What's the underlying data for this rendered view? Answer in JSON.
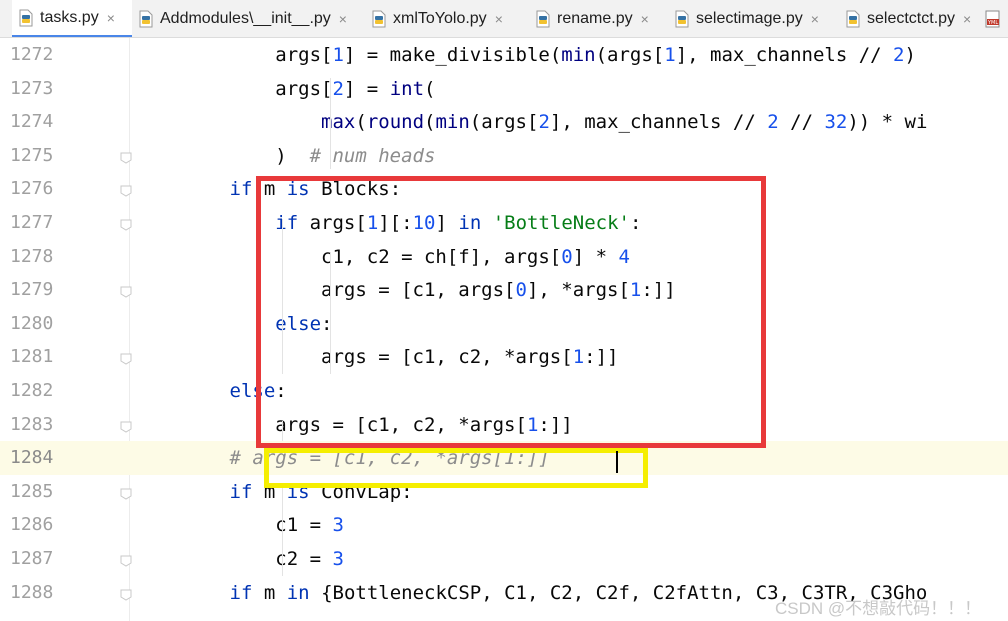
{
  "tabs": [
    {
      "label": "tasks.py",
      "active": true,
      "icon": "python-file-icon"
    },
    {
      "label": "Addmodules\\__init__.py",
      "active": false,
      "icon": "python-file-icon"
    },
    {
      "label": "xmlToYolo.py",
      "active": false,
      "icon": "python-file-icon"
    },
    {
      "label": "rename.py",
      "active": false,
      "icon": "python-file-icon"
    },
    {
      "label": "selectimage.py",
      "active": false,
      "icon": "python-file-icon"
    },
    {
      "label": "selectctct.py",
      "active": false,
      "icon": "python-file-icon"
    },
    {
      "label": "",
      "active": false,
      "icon": "yaml-file-icon"
    }
  ],
  "close_glyph": "×",
  "lines": [
    {
      "num": "1272",
      "segments": [
        {
          "t": "            args[",
          "c": ""
        },
        {
          "t": "1",
          "c": "num"
        },
        {
          "t": "] = make_divisible(",
          "c": ""
        },
        {
          "t": "min",
          "c": "bi"
        },
        {
          "t": "(args[",
          "c": ""
        },
        {
          "t": "1",
          "c": "num"
        },
        {
          "t": "], max_channels // ",
          "c": ""
        },
        {
          "t": "2",
          "c": "num"
        },
        {
          "t": ")",
          "c": ""
        }
      ]
    },
    {
      "num": "1273",
      "segments": [
        {
          "t": "            args[",
          "c": ""
        },
        {
          "t": "2",
          "c": "num"
        },
        {
          "t": "] = ",
          "c": ""
        },
        {
          "t": "int",
          "c": "bi"
        },
        {
          "t": "(",
          "c": ""
        }
      ]
    },
    {
      "num": "1274",
      "segments": [
        {
          "t": "                ",
          "c": ""
        },
        {
          "t": "max",
          "c": "bi"
        },
        {
          "t": "(",
          "c": ""
        },
        {
          "t": "round",
          "c": "bi"
        },
        {
          "t": "(",
          "c": ""
        },
        {
          "t": "min",
          "c": "bi"
        },
        {
          "t": "(args[",
          "c": ""
        },
        {
          "t": "2",
          "c": "num"
        },
        {
          "t": "], max_channels // ",
          "c": ""
        },
        {
          "t": "2",
          "c": "num"
        },
        {
          "t": " // ",
          "c": ""
        },
        {
          "t": "32",
          "c": "num"
        },
        {
          "t": ")) * wi",
          "c": ""
        }
      ]
    },
    {
      "num": "1275",
      "segments": [
        {
          "t": "            )  ",
          "c": ""
        },
        {
          "t": "# num heads",
          "c": "cmt"
        }
      ]
    },
    {
      "num": "1276",
      "segments": [
        {
          "t": "        ",
          "c": ""
        },
        {
          "t": "if",
          "c": "kw"
        },
        {
          "t": " m ",
          "c": ""
        },
        {
          "t": "is",
          "c": "kw"
        },
        {
          "t": " Blocks:",
          "c": ""
        }
      ]
    },
    {
      "num": "1277",
      "segments": [
        {
          "t": "            ",
          "c": ""
        },
        {
          "t": "if",
          "c": "kw"
        },
        {
          "t": " args[",
          "c": ""
        },
        {
          "t": "1",
          "c": "num"
        },
        {
          "t": "][:",
          "c": ""
        },
        {
          "t": "10",
          "c": "num"
        },
        {
          "t": "] ",
          "c": ""
        },
        {
          "t": "in",
          "c": "kw"
        },
        {
          "t": " ",
          "c": ""
        },
        {
          "t": "'BottleNeck'",
          "c": "str"
        },
        {
          "t": ":",
          "c": ""
        }
      ]
    },
    {
      "num": "1278",
      "segments": [
        {
          "t": "                c1, c2 = ch[f], args[",
          "c": ""
        },
        {
          "t": "0",
          "c": "num"
        },
        {
          "t": "] * ",
          "c": ""
        },
        {
          "t": "4",
          "c": "num"
        }
      ]
    },
    {
      "num": "1279",
      "segments": [
        {
          "t": "                args = [c1, args[",
          "c": ""
        },
        {
          "t": "0",
          "c": "num"
        },
        {
          "t": "], *args[",
          "c": ""
        },
        {
          "t": "1",
          "c": "num"
        },
        {
          "t": ":]]",
          "c": ""
        }
      ]
    },
    {
      "num": "1280",
      "segments": [
        {
          "t": "            ",
          "c": ""
        },
        {
          "t": "else",
          "c": "kw"
        },
        {
          "t": ":",
          "c": ""
        }
      ]
    },
    {
      "num": "1281",
      "segments": [
        {
          "t": "                args = [c1, c2, *args[",
          "c": ""
        },
        {
          "t": "1",
          "c": "num"
        },
        {
          "t": ":]]",
          "c": ""
        }
      ]
    },
    {
      "num": "1282",
      "segments": [
        {
          "t": "        ",
          "c": ""
        },
        {
          "t": "else",
          "c": "kw"
        },
        {
          "t": ":",
          "c": ""
        }
      ]
    },
    {
      "num": "1283",
      "segments": [
        {
          "t": "            args = [c1, c2, *args[",
          "c": ""
        },
        {
          "t": "1",
          "c": "num"
        },
        {
          "t": ":]]",
          "c": ""
        }
      ]
    },
    {
      "num": "1284",
      "current": true,
      "segments": [
        {
          "t": "        ",
          "c": ""
        },
        {
          "t": "# args = [c1, c2, *args[1:]]",
          "c": "cmt"
        }
      ]
    },
    {
      "num": "1285",
      "segments": [
        {
          "t": "        ",
          "c": ""
        },
        {
          "t": "if",
          "c": "kw"
        },
        {
          "t": " m ",
          "c": ""
        },
        {
          "t": "is",
          "c": "kw"
        },
        {
          "t": " ConvLap:",
          "c": ""
        }
      ]
    },
    {
      "num": "1286",
      "segments": [
        {
          "t": "            c1 = ",
          "c": ""
        },
        {
          "t": "3",
          "c": "num"
        }
      ]
    },
    {
      "num": "1287",
      "segments": [
        {
          "t": "            c2 = ",
          "c": ""
        },
        {
          "t": "3",
          "c": "num"
        }
      ]
    },
    {
      "num": "1288",
      "segments": [
        {
          "t": "        ",
          "c": ""
        },
        {
          "t": "if",
          "c": "kw"
        },
        {
          "t": " m ",
          "c": ""
        },
        {
          "t": "in",
          "c": "kw"
        },
        {
          "t": " {BottleneckCSP, C1, C2, C2f, C2fAttn, C3, C3TR, C3Gho",
          "c": ""
        }
      ]
    }
  ],
  "fold_markers": [
    "1275",
    "1276",
    "1277",
    "1279",
    "1281",
    "1283",
    "1285",
    "1287",
    "1288"
  ],
  "watermark": "CSDN @不想敲代码！！！",
  "colors": {
    "red_box": "#e8393a",
    "yellow_box": "#f5ee00",
    "keyword": "#0033b3",
    "number": "#1750eb",
    "string": "#067d17",
    "comment": "#8c8c8c"
  }
}
